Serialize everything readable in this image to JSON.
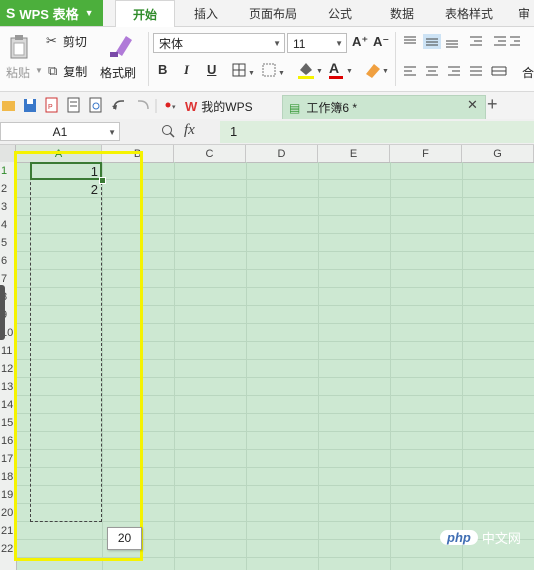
{
  "app": {
    "name": "WPS 表格"
  },
  "tabs": [
    "开始",
    "插入",
    "页面布局",
    "公式",
    "数据",
    "表格样式",
    "审"
  ],
  "ribbon": {
    "paste": "粘贴",
    "cut": "剪切",
    "copy": "复制",
    "format_painter": "格式刷",
    "font_name": "宋体",
    "font_size": "11",
    "bold": "B",
    "italic": "I",
    "underline": "U",
    "grow": "A⁺",
    "shrink": "A⁻",
    "merge": "合"
  },
  "doc_tabs": {
    "mywps": "我的WPS",
    "workbook": "工作簿6 *"
  },
  "formula_bar": {
    "name_box": "A1",
    "fx": "fx",
    "value": "1"
  },
  "columns": [
    "A",
    "B",
    "C",
    "D",
    "E",
    "F",
    "G"
  ],
  "rows": [
    "1",
    "2",
    "3",
    "4",
    "5",
    "6",
    "7",
    "8",
    "9",
    "10",
    "11",
    "12",
    "13",
    "14",
    "15",
    "16",
    "17",
    "18",
    "19",
    "20",
    "21",
    "22"
  ],
  "cells": {
    "a1": "1",
    "a2": "2"
  },
  "fill_tooltip": "20",
  "watermark": {
    "brand": "php",
    "text": "中文网"
  },
  "colors": {
    "accent": "#4caf3c",
    "grid_bg": "#cde8d2",
    "highlight": "#f5f300"
  }
}
